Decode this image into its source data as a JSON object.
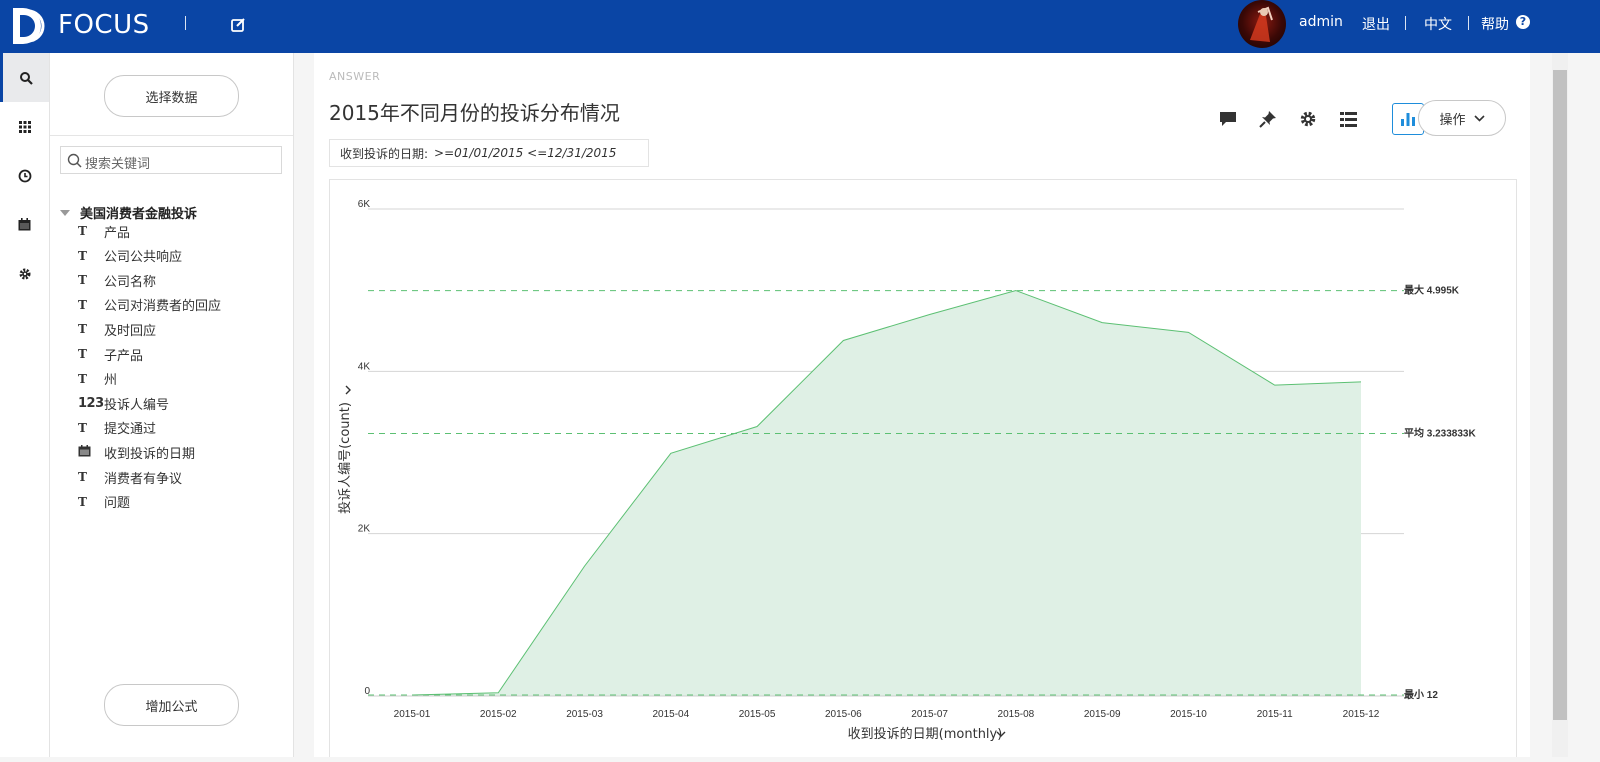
{
  "app": {
    "logo_text": "FOCUS"
  },
  "topbar": {
    "username": "admin",
    "logout": "退出",
    "language": "中文",
    "help": "帮助",
    "help_icon": "?"
  },
  "iconbar": [
    "search-icon",
    "grid-icon",
    "history-icon",
    "calendar-icon",
    "gear-icon"
  ],
  "datapanel": {
    "select_data": "选择数据",
    "search_placeholder": "搜索关键词",
    "dataset_name": "美国消费者金融投诉",
    "fields": [
      {
        "type": "text",
        "icon": "T",
        "label": "产品"
      },
      {
        "type": "text",
        "icon": "T",
        "label": "公司公共响应"
      },
      {
        "type": "text",
        "icon": "T",
        "label": "公司名称"
      },
      {
        "type": "text",
        "icon": "T",
        "label": "公司对消费者的回应"
      },
      {
        "type": "text",
        "icon": "T",
        "label": "及时回应"
      },
      {
        "type": "text",
        "icon": "T",
        "label": "子产品"
      },
      {
        "type": "text",
        "icon": "T",
        "label": "州"
      },
      {
        "type": "number",
        "icon": "123",
        "label": "投诉人编号"
      },
      {
        "type": "text",
        "icon": "T",
        "label": "提交通过"
      },
      {
        "type": "date",
        "icon": "calendar",
        "label": "收到投诉的日期"
      },
      {
        "type": "text",
        "icon": "T",
        "label": "消费者有争议"
      },
      {
        "type": "text",
        "icon": "T",
        "label": "问题"
      }
    ],
    "add_formula": "增加公式"
  },
  "answer": {
    "label": "ANSWER",
    "title": "2015年不同月份的投诉分布情况",
    "filter_field": "收到投诉的日期:",
    "filter_value": ">=01/01/2015   <=12/31/2015",
    "ops_label": "操作"
  },
  "toolbar": [
    "comment-icon",
    "pin-icon",
    "settings-icon",
    "table-view-icon",
    "chart-view-icon"
  ],
  "colors": {
    "brand": "#0a45a5",
    "area_fill": "#dff0e5",
    "area_line": "#5cc073",
    "ref_line": "#5cc073"
  },
  "chart_data": {
    "type": "area",
    "x": [
      "2015-01",
      "2015-02",
      "2015-03",
      "2015-04",
      "2015-05",
      "2015-06",
      "2015-07",
      "2015-08",
      "2015-09",
      "2015-10",
      "2015-11",
      "2015-12"
    ],
    "values": [
      12,
      40,
      1600,
      2990,
      3320,
      4380,
      4700,
      4995,
      4600,
      4480,
      3830,
      3870
    ],
    "ylabel": "投诉人编号(count)",
    "xlabel": "收到投诉的日期(monthly)",
    "ylim": [
      0,
      6000
    ],
    "yticks": [
      {
        "value": 0,
        "label": "0"
      },
      {
        "value": 2000,
        "label": "2K"
      },
      {
        "value": 4000,
        "label": "4K"
      },
      {
        "value": 6000,
        "label": "6K"
      }
    ],
    "reference_lines": [
      {
        "value": 4995,
        "label": "最大 4.995K"
      },
      {
        "value": 3233.833,
        "label": "平均 3.233833K"
      },
      {
        "value": 12,
        "label": "最小 12"
      }
    ],
    "grid": true
  }
}
